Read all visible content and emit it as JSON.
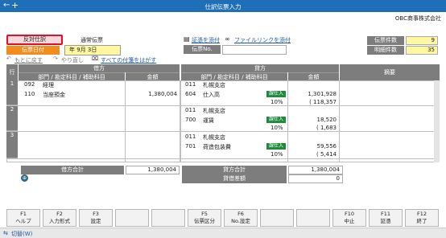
{
  "window": {
    "title": "仕訳伝票入力",
    "company": "OBC商事株式会社"
  },
  "header": {
    "reverse_entry_label": "反対仕訳",
    "slip_type": "通常伝票",
    "date_label": "伝票日付",
    "date_value": "年  9月  3日",
    "attach_voucher_link": "証憑を添付",
    "attach_file_link": "ファイルリンクを添付",
    "slip_no_label": "伝票No.",
    "slip_no_value": "",
    "undo_label": "もとに戻す",
    "redo_label": "やり直し",
    "remove_attachments_link": "すべての付箋をはがす",
    "slip_count_label": "伝票件数",
    "slip_count_value": "9",
    "detail_count_label": "明細件数",
    "detail_count_value": "35"
  },
  "table": {
    "row_header": "行",
    "debit_header": "借方",
    "credit_header": "貸方",
    "summary_header": "摘要",
    "account_header": "部門 / 勘定科目 / 補助科目",
    "amount_header": "金額",
    "rows": [
      {
        "num": "1",
        "debit": {
          "dept_code": "092",
          "dept_name": "経理",
          "acct_code": "110",
          "acct_name": "当座預金",
          "amount": "1,380,004"
        },
        "credit": {
          "dept_code": "011",
          "dept_name": "札幌支店",
          "acct_code": "604",
          "acct_name": "仕入高",
          "tax_tag": "課仕入",
          "amount": "1,301,928",
          "tax_rate": "10%",
          "tax_amount": "( 118,357"
        }
      },
      {
        "num": "2",
        "credit": {
          "dept_code": "011",
          "dept_name": "札幌支店",
          "acct_code": "700",
          "acct_name": "運賃",
          "tax_tag": "課仕入",
          "amount": "18,520",
          "tax_rate": "10%",
          "tax_amount": "( 1,683"
        }
      },
      {
        "num": "3",
        "credit": {
          "dept_code": "011",
          "dept_name": "札幌支店",
          "acct_code": "701",
          "acct_name": "荷造包装費",
          "tax_tag": "課仕入",
          "amount": "59,556",
          "tax_rate": "10%",
          "tax_amount": "( 5,414"
        }
      }
    ],
    "debit_total_label": "借方合計",
    "debit_total": "1,380,004",
    "credit_total_label": "貸方合計",
    "credit_total": "1,380,004",
    "diff_label": "貸借差額",
    "diff_value": "0"
  },
  "function_keys": [
    {
      "key": "F1",
      "label": "ヘルプ"
    },
    {
      "key": "F2",
      "label": "入力形式"
    },
    {
      "key": "F3",
      "label": "設定"
    },
    {
      "key": "",
      "label": ""
    },
    {
      "key": "",
      "label": ""
    },
    {
      "key": "F5",
      "label": "伝票区分"
    },
    {
      "key": "F6",
      "label": "No.設定"
    },
    {
      "key": "",
      "label": ""
    },
    {
      "key": "",
      "label": ""
    },
    {
      "key": "F10",
      "label": "中止"
    },
    {
      "key": "F11",
      "label": "証憑"
    },
    {
      "key": "F12",
      "label": "終了"
    }
  ],
  "status": {
    "switch_label": "切替(W)"
  }
}
